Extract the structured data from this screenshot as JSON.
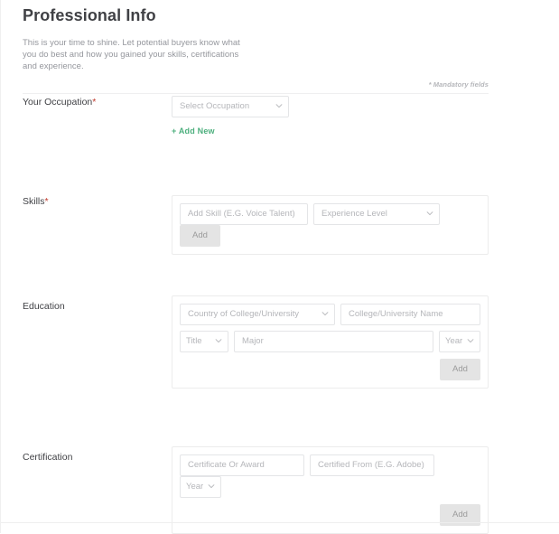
{
  "header": {
    "title": "Professional Info",
    "description": "This is your time to shine. Let potential buyers know what you do best and how you gained your skills, certifications and experience.",
    "mandatory_note": "* Mandatory fields"
  },
  "occupation": {
    "label": "Your Occupation",
    "required_mark": "*",
    "select_placeholder": "Select Occupation",
    "add_new_label": "+ Add New"
  },
  "skills": {
    "label": "Skills",
    "required_mark": "*",
    "skill_placeholder": "Add Skill (E.G. Voice Talent)",
    "level_placeholder": "Experience Level",
    "add_label": "Add"
  },
  "education": {
    "label": "Education",
    "country_placeholder": "Country of College/University",
    "name_placeholder": "College/University Name",
    "title_placeholder": "Title",
    "major_placeholder": "Major",
    "year_placeholder": "Year",
    "add_label": "Add"
  },
  "certification": {
    "label": "Certification",
    "certificate_placeholder": "Certificate Or Award",
    "certified_from_placeholder": "Certified From (E.G. Adobe)",
    "year_placeholder": "Year",
    "add_label": "Add"
  },
  "colors": {
    "accent_green": "#4caf7d",
    "required_red": "#c0392b",
    "heading": "#404145",
    "placeholder": "#b5b6ba",
    "button_bg": "#e4e4e4"
  }
}
